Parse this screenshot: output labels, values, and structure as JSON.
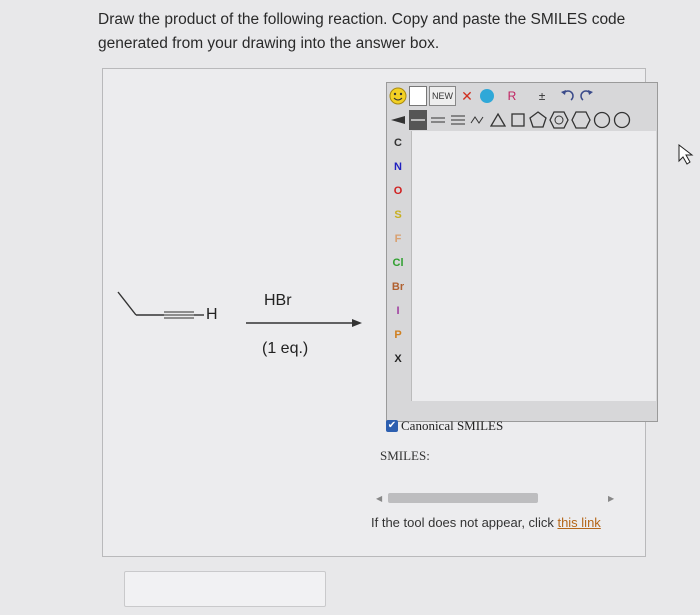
{
  "question": {
    "line1": "Draw the product of the following reaction. Copy and paste the SMILES code",
    "line2": "generated from your drawing into the answer box."
  },
  "reaction": {
    "terminal_label": "H",
    "reagent": "HBr",
    "condition": "(1 eq.)"
  },
  "editor": {
    "toolbar_row1": {
      "new_label": "NEW",
      "delete_symbol": "✕",
      "r_label": "R",
      "charge_label": "±"
    },
    "atoms": [
      "C",
      "N",
      "O",
      "S",
      "F",
      "Cl",
      "Br",
      "I",
      "P",
      "X"
    ],
    "atom_colors": [
      "#333333",
      "#2020c0",
      "#d02020",
      "#c8b020",
      "#d8a070",
      "#30a030",
      "#b06030",
      "#a040a0",
      "#d08020",
      "#222222"
    ],
    "canonical_smiles_label": "Canonical SMILES",
    "canonical_checked": true,
    "smiles_label": "SMILES:"
  },
  "note": {
    "text": "If the tool does not appear, click ",
    "link": "this link"
  },
  "answer_box": {
    "value": ""
  }
}
